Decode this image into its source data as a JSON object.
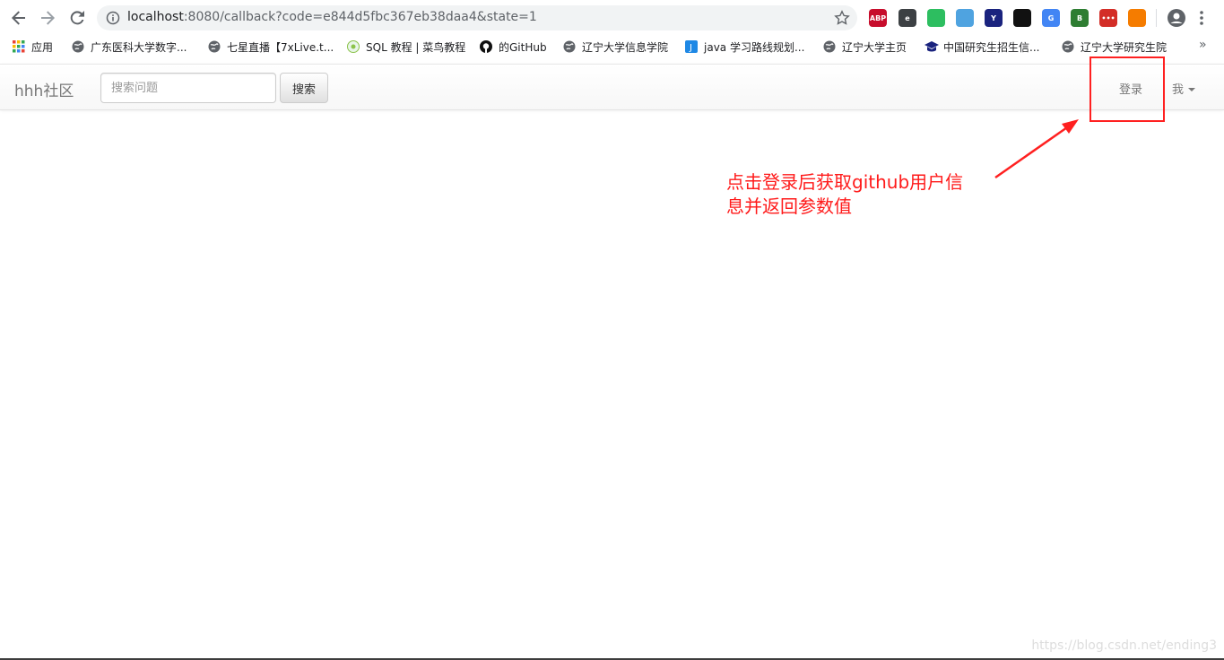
{
  "browser": {
    "url_host": "localhost",
    "url_rest": ":8080/callback?code=e844d5fbc367eb38daa4&state=1",
    "extensions": [
      {
        "name": "adblock-plus-icon",
        "label": "ABP",
        "color": "#c70d2c"
      },
      {
        "name": "extension-e-icon",
        "label": "e",
        "color": "#3c4043"
      },
      {
        "name": "evernote-icon",
        "label": "",
        "color": "#2dbe60"
      },
      {
        "name": "extension-v-icon",
        "label": "",
        "color": "#4fa3e0"
      },
      {
        "name": "extension-y-icon",
        "label": "Y",
        "color": "#1a237e"
      },
      {
        "name": "extension-mask-icon",
        "label": "",
        "color": "#111111"
      },
      {
        "name": "google-translate-icon",
        "label": "G",
        "color": "#4285f4"
      },
      {
        "name": "extension-b-icon",
        "label": "B",
        "color": "#2e7d32"
      },
      {
        "name": "lastpass-icon",
        "label": "•••",
        "color": "#d32d27"
      },
      {
        "name": "extension-s-icon",
        "label": "",
        "color": "#f57c00"
      }
    ]
  },
  "bookmarks": [
    {
      "label": "应用",
      "icon": "apps-grid-icon"
    },
    {
      "label": "广东医科大学数字...",
      "icon": "globe-icon"
    },
    {
      "label": "七星直播【7xLive.t...",
      "icon": "globe-icon"
    },
    {
      "label": "SQL 教程 | 菜鸟教程",
      "icon": "runoob-icon"
    },
    {
      "label": "的GitHub",
      "icon": "github-icon"
    },
    {
      "label": "辽宁大学信息学院",
      "icon": "globe-icon"
    },
    {
      "label": "java 学习路线规划...",
      "icon": "j-icon"
    },
    {
      "label": "辽宁大学主页",
      "icon": "globe-icon"
    },
    {
      "label": "中国研究生招生信...",
      "icon": "graduation-cap-icon"
    },
    {
      "label": "辽宁大学研究生院",
      "icon": "globe-icon"
    }
  ],
  "site": {
    "brand": "hhh社区",
    "search_placeholder": "搜索问题",
    "search_button": "搜索",
    "login": "登录",
    "me": "我"
  },
  "annotation": {
    "line1": "点击登录后获取github用户信",
    "line2": "息并返回参数值",
    "color": "#ff1a1a"
  },
  "watermark": "https://blog.csdn.net/ending3"
}
